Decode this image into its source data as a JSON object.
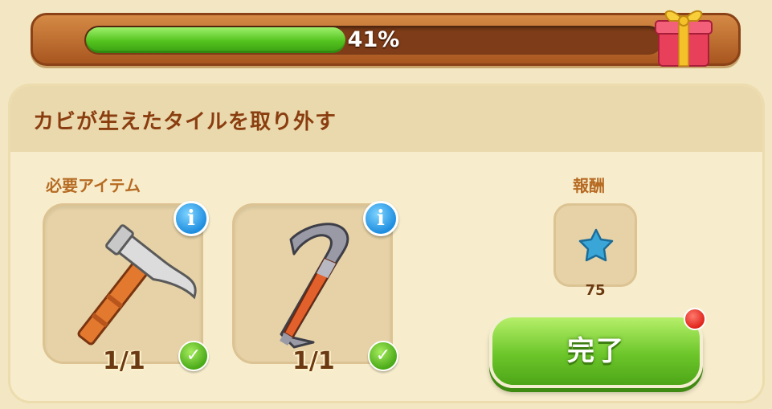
{
  "progress": {
    "percent_label": "41%",
    "value": 0.41,
    "fill_color": "#52c21e"
  },
  "header_icon": "gift-box-icon",
  "task": {
    "title": "カビが生えたタイルを取り外す"
  },
  "required_items": {
    "label": "必要アイテム",
    "items": [
      {
        "icon": "hammer-icon",
        "count": "1/1",
        "info_icon": "info-icon",
        "status_icon": "checkmark-icon"
      },
      {
        "icon": "crowbar-icon",
        "count": "1/1",
        "info_icon": "info-icon",
        "status_icon": "checkmark-icon"
      }
    ]
  },
  "reward": {
    "label": "報酬",
    "icon": "blue-star-icon",
    "amount": "75"
  },
  "done_button": {
    "label": "完了",
    "badge_icon": "red-notification-dot"
  },
  "info_glyph": "i",
  "check_glyph": "✓"
}
